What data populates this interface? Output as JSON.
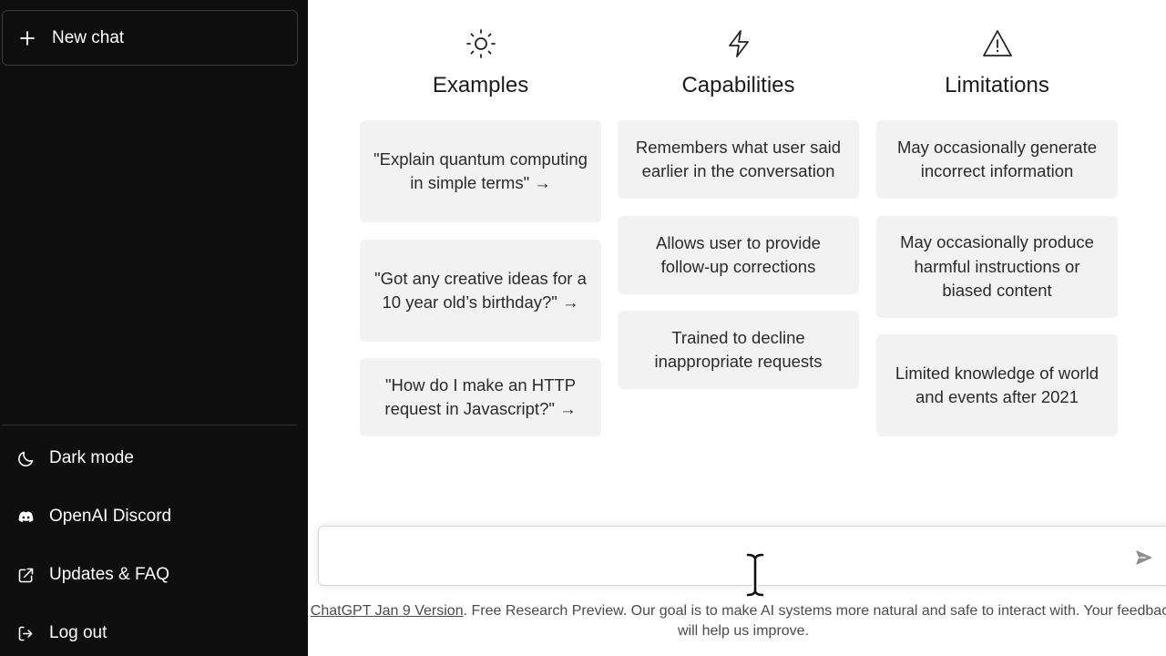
{
  "sidebar": {
    "new_chat": {
      "label": "New chat",
      "icon": "plus-icon"
    },
    "items": [
      {
        "label": "Dark mode",
        "icon": "moon-icon"
      },
      {
        "label": "OpenAI Discord",
        "icon": "discord-icon"
      },
      {
        "label": "Updates & FAQ",
        "icon": "external-link-icon"
      },
      {
        "label": "Log out",
        "icon": "logout-icon"
      }
    ]
  },
  "main": {
    "columns": [
      {
        "title": "Examples",
        "icon": "sun-icon",
        "cards": [
          "\"Explain quantum computing in simple terms\" →",
          "\"Got any creative ideas for a 10 year old’s birthday?\" →",
          "\"How do I make an HTTP request in Javascript?\" →"
        ]
      },
      {
        "title": "Capabilities",
        "icon": "lightning-icon",
        "cards": [
          "Remembers what user said earlier in the conversation",
          "Allows user to provide follow-up corrections",
          "Trained to decline inappropriate requests"
        ]
      },
      {
        "title": "Limitations",
        "icon": "warning-icon",
        "cards": [
          "May occasionally generate incorrect information",
          "May occasionally produce harmful instructions or biased content",
          "Limited knowledge of world and events after 2021"
        ]
      }
    ]
  },
  "input": {
    "value": "",
    "send_icon": "send-icon"
  },
  "footer": {
    "link": "ChatGPT Jan 9 Version",
    "text": ". Free Research Preview. Our goal is to make AI systems more natural and safe to interact with. Your feedback will help us improve."
  },
  "colors": {
    "sidebar_bg": "#0f0f10",
    "card_bg": "#f2f2f3",
    "text": "#1f1f1f"
  }
}
